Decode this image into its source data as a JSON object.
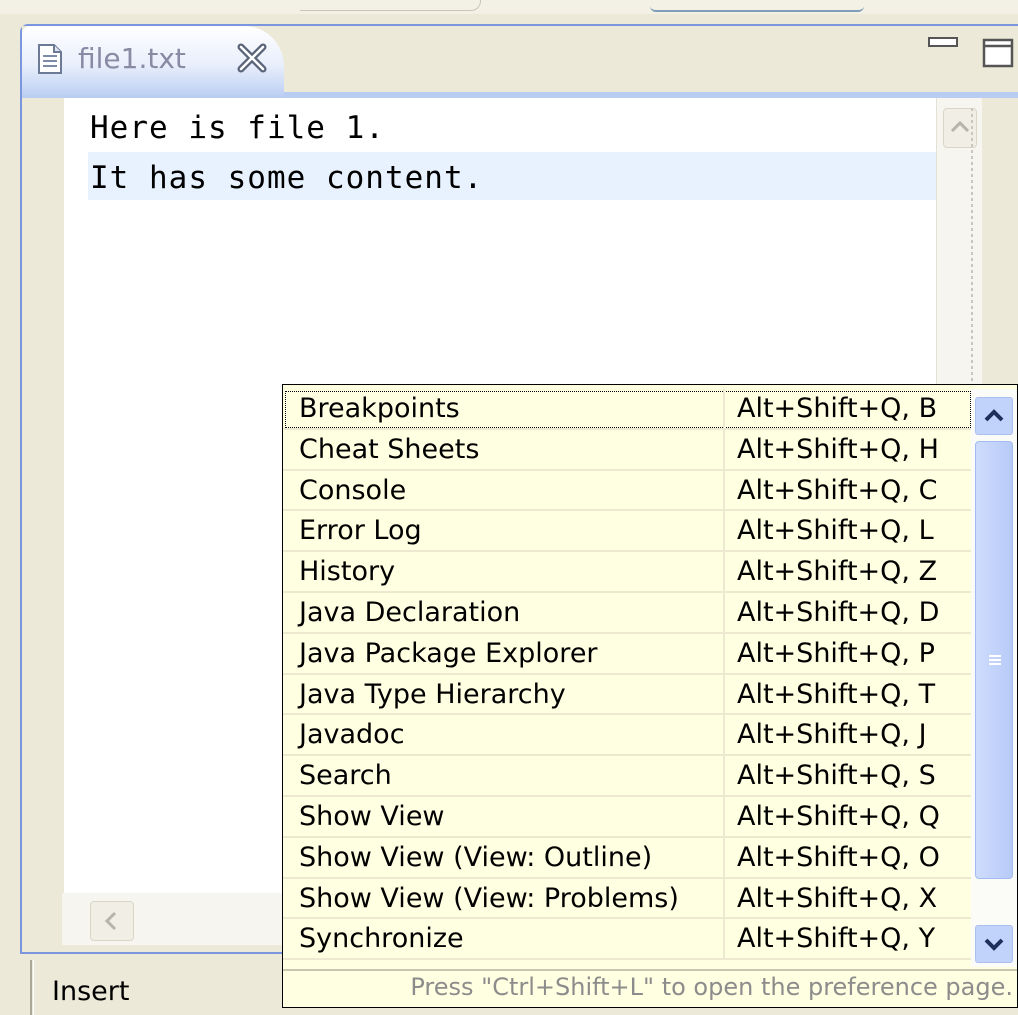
{
  "editor": {
    "tab_title": "file1.txt",
    "lines": [
      "Here is file 1.",
      "It has some content."
    ]
  },
  "status_bar": {
    "mode": "Insert"
  },
  "quick_access": {
    "items": [
      {
        "name": "Breakpoints",
        "shortcut": "Alt+Shift+Q, B"
      },
      {
        "name": "Cheat Sheets",
        "shortcut": "Alt+Shift+Q, H"
      },
      {
        "name": "Console",
        "shortcut": "Alt+Shift+Q, C"
      },
      {
        "name": "Error Log",
        "shortcut": "Alt+Shift+Q, L"
      },
      {
        "name": "History",
        "shortcut": "Alt+Shift+Q, Z"
      },
      {
        "name": "Java Declaration",
        "shortcut": "Alt+Shift+Q, D"
      },
      {
        "name": "Java Package Explorer",
        "shortcut": "Alt+Shift+Q, P"
      },
      {
        "name": "Java Type Hierarchy",
        "shortcut": "Alt+Shift+Q, T"
      },
      {
        "name": "Javadoc",
        "shortcut": "Alt+Shift+Q, J"
      },
      {
        "name": "Search",
        "shortcut": "Alt+Shift+Q, S"
      },
      {
        "name": "Show View",
        "shortcut": "Alt+Shift+Q, Q"
      },
      {
        "name": "Show View (View: Outline)",
        "shortcut": "Alt+Shift+Q, O"
      },
      {
        "name": "Show View (View: Problems)",
        "shortcut": "Alt+Shift+Q, X"
      },
      {
        "name": "Synchronize",
        "shortcut": "Alt+Shift+Q, Y"
      }
    ],
    "selected_item": "Breakpoints",
    "footer_hint": "Press \"Ctrl+Shift+L\" to open the preference page."
  },
  "icons": {
    "tab_file": "text-file-icon",
    "tab_close": "close-icon",
    "minimize": "minimize-icon",
    "maximize": "maximize-icon",
    "scroll_up": "chevron-up-icon",
    "scroll_down": "chevron-down-icon",
    "scroll_left": "chevron-left-icon"
  },
  "colors": {
    "frame_accent": "#7a96df",
    "popup_background": "#ffffe1",
    "current_line_highlight": "#e8f2fe"
  }
}
